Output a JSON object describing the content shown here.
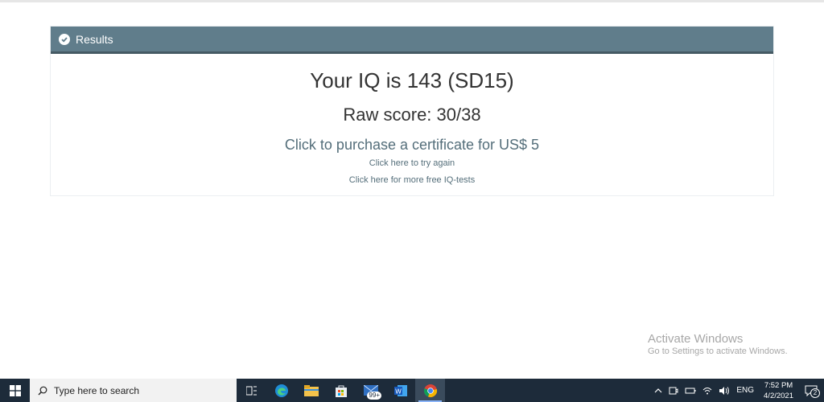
{
  "panel": {
    "title": "Results",
    "iq_text": "Your IQ is 143 (SD15)",
    "raw_text": "Raw score: 30/38",
    "certificate_link": "Click to purchase a certificate for US$ 5",
    "retry_link": "Click here to try again",
    "more_tests_link": "Click here for more free IQ-tests"
  },
  "watermark": {
    "line1": "Activate Windows",
    "line2": "Go to Settings to activate Windows."
  },
  "taskbar": {
    "search_placeholder": "Type here to search",
    "mail_badge": "99+",
    "language": "ENG",
    "time": "7:52 PM",
    "date": "4/2/2021",
    "notification_count": "2",
    "pinned_icons": [
      "task-view-icon",
      "edge-icon",
      "file-explorer-icon",
      "store-icon",
      "mail-icon",
      "word-icon",
      "chrome-icon"
    ]
  },
  "colors": {
    "header_bg": "#607d8b",
    "header_border": "#455a64",
    "link": "#546e7a",
    "taskbar": "#1d2b3a"
  }
}
